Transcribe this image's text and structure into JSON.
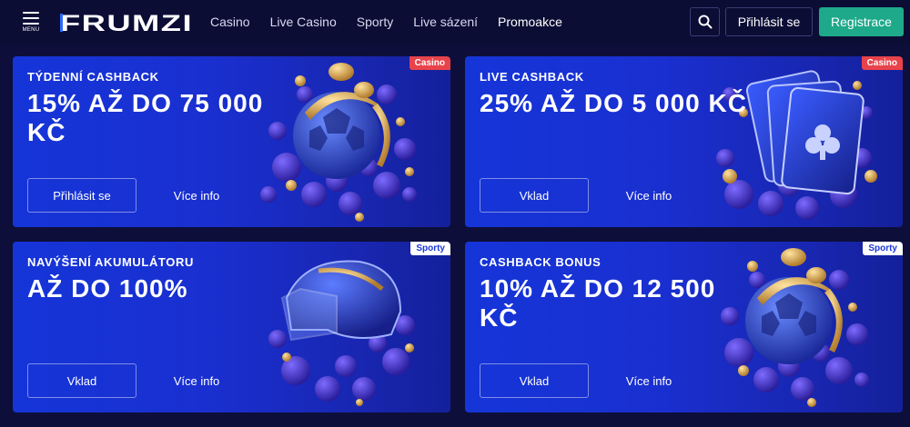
{
  "header": {
    "menu_label": "MENU",
    "logo_text": "FRUMZI",
    "nav": [
      "Casino",
      "Live Casino",
      "Sporty",
      "Live sázení",
      "Promoakce"
    ],
    "active_nav": "Promoakce",
    "login_label": "Přihlásit se",
    "register_label": "Registrace",
    "search_icon": "search-icon"
  },
  "colors": {
    "background": "#0d0f3a",
    "card": "#1a2fd0",
    "register": "#1ea98a",
    "casino_badge": "#e8434b",
    "sporty_badge": "#ffffff"
  },
  "cards": [
    {
      "badge": "Casino",
      "subtitle": "TÝDENNÍ CASHBACK",
      "headline": "15% AŽ DO 75 000 KČ",
      "primary_label": "Přihlásit se",
      "secondary_label": "Více info",
      "art": "football-coins-art"
    },
    {
      "badge": "Casino",
      "subtitle": "LIVE CASHBACK",
      "headline": "25% AŽ DO 5 000 KČ",
      "primary_label": "Vklad",
      "secondary_label": "Více info",
      "art": "playing-cards-art"
    },
    {
      "badge": "Sporty",
      "subtitle": "NAVÝŠENÍ AKUMULÁTORU",
      "headline": "AŽ DO 100%",
      "primary_label": "Vklad",
      "secondary_label": "Více info",
      "art": "hockey-helmet-art"
    },
    {
      "badge": "Sporty",
      "subtitle": "CASHBACK BONUS",
      "headline": "10% AŽ DO 12 500 KČ",
      "primary_label": "Vklad",
      "secondary_label": "Více info",
      "art": "football-coins-art"
    }
  ]
}
